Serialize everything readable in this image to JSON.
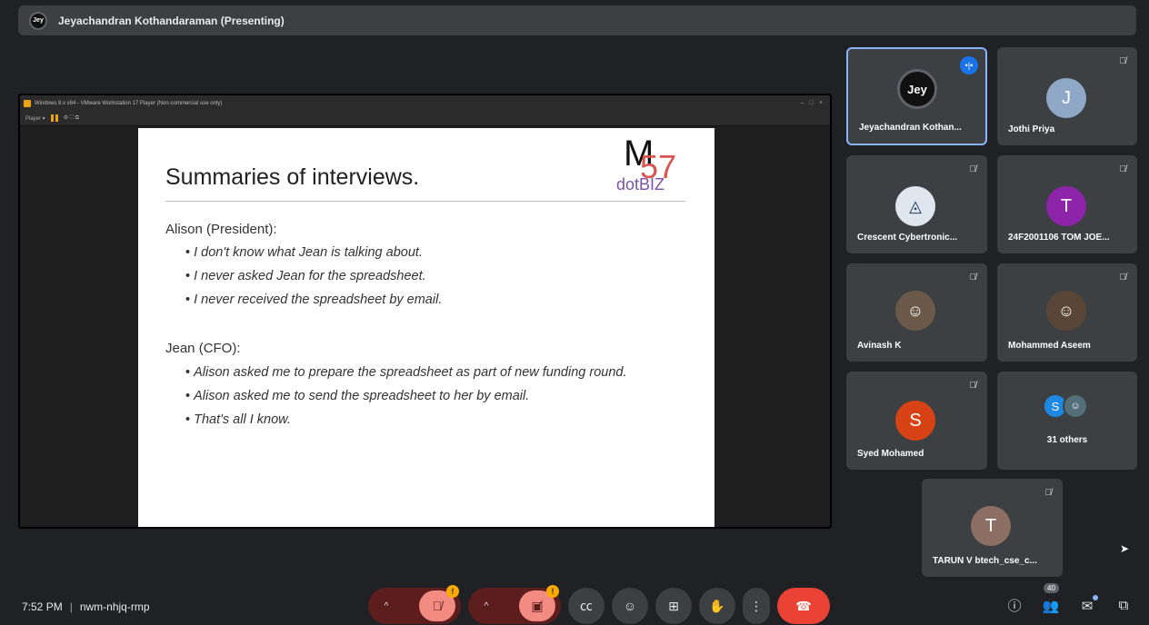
{
  "presenter": {
    "badge": "Jey",
    "name": "Jeyachandran Kothandaraman (Presenting)"
  },
  "vm": {
    "title": "Windows 8.x x64 - VMware Workstation 17 Player (Non-commercial use only)",
    "menu": "Player ▾"
  },
  "slide": {
    "title": "Summaries of interviews.",
    "logo": {
      "m": "M",
      "num": "57",
      "sub": "dotBIZ"
    },
    "sections": [
      {
        "speaker": "Alison (President):",
        "bullets": [
          "I don't know what Jean is talking about.",
          "I never asked Jean for the spreadsheet.",
          "I never received the spreadsheet by email."
        ]
      },
      {
        "speaker": "Jean (CFO):",
        "bullets": [
          "Alison asked me to prepare the spreadsheet as part of new funding round.",
          "Alison asked me to send the spreadsheet to her by email.",
          "That's all I know."
        ]
      }
    ]
  },
  "participants": [
    {
      "name": "Jeyachandran Kothan...",
      "initial": "Jey",
      "color": "#111111"
    },
    {
      "name": "Jothi Priya",
      "initial": "J",
      "color": "#8fa8c8"
    },
    {
      "name": "Crescent Cybertronic...",
      "initial": "",
      "color": "#dfe6ee"
    },
    {
      "name": "24F2001106 TOM JOE...",
      "initial": "T",
      "color": "#8e24aa"
    },
    {
      "name": "Avinash K",
      "initial": "",
      "color": "#6b5a4a"
    },
    {
      "name": "Mohammed Aseem",
      "initial": "",
      "color": "#5a4636"
    },
    {
      "name": "Syed Mohamed",
      "initial": "S",
      "color": "#d84315"
    },
    {
      "name": "TARUN V btech_cse_c...",
      "initial": "T",
      "color": "#8d6e63"
    }
  ],
  "others": {
    "initial": "S",
    "label": "31 others",
    "color": "#1e88e5"
  },
  "meeting": {
    "time": "7:52 PM",
    "separator": "|",
    "code": "nwm-nhjq-rmp"
  },
  "people_count": "40",
  "icons": {
    "mute": "🎤̸",
    "warning": "!"
  }
}
